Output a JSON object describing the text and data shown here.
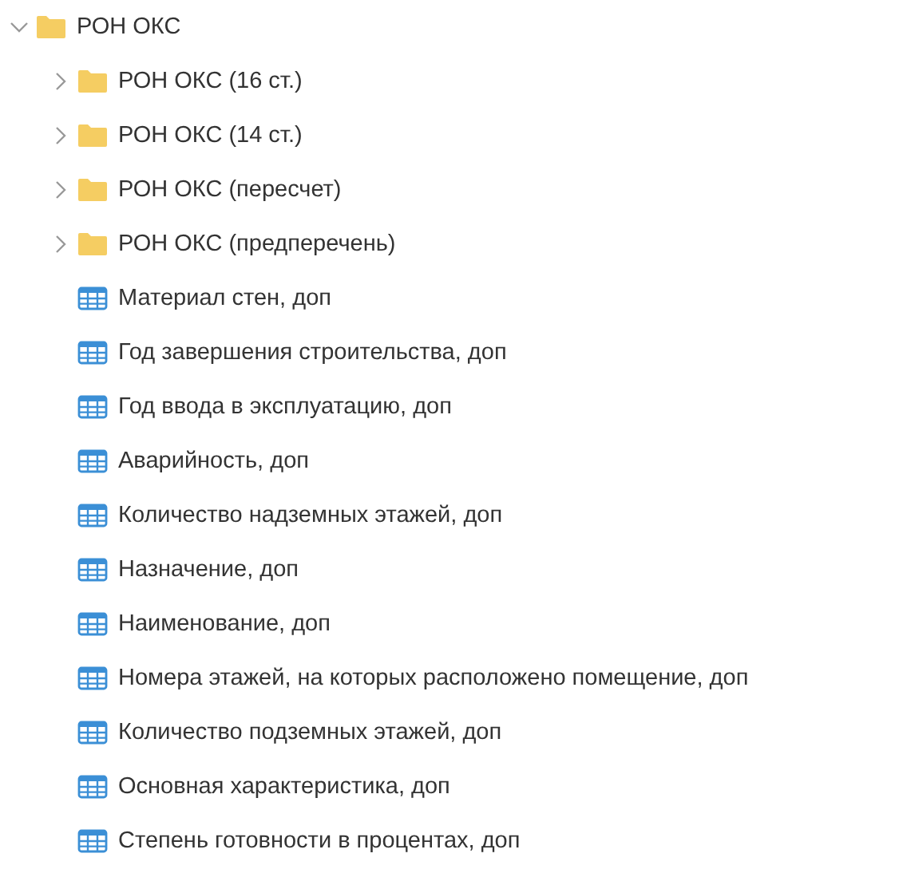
{
  "tree": [
    {
      "label": "РОН ОКС",
      "kind": "folder",
      "expanded": true,
      "children": [
        {
          "label": "РОН ОКС (16 ст.)",
          "kind": "folder",
          "expanded": false
        },
        {
          "label": "РОН ОКС (14 ст.)",
          "kind": "folder",
          "expanded": false
        },
        {
          "label": "РОН ОКС (пересчет)",
          "kind": "folder",
          "expanded": false
        },
        {
          "label": "РОН ОКС (предперечень)",
          "kind": "folder",
          "expanded": false
        },
        {
          "label": "Материал стен, доп",
          "kind": "table"
        },
        {
          "label": "Год завершения строительства, доп",
          "kind": "table"
        },
        {
          "label": "Год ввода в эксплуатацию, доп",
          "kind": "table"
        },
        {
          "label": "Аварийность, доп",
          "kind": "table"
        },
        {
          "label": "Количество надземных этажей, доп",
          "kind": "table"
        },
        {
          "label": "Назначение, доп",
          "kind": "table"
        },
        {
          "label": "Наименование, доп",
          "kind": "table"
        },
        {
          "label": "Номера этажей, на которых расположено помещение, доп",
          "kind": "table"
        },
        {
          "label": "Количество подземных этажей, доп",
          "kind": "table"
        },
        {
          "label": "Основная характеристика, доп",
          "kind": "table"
        },
        {
          "label": "Степень готовности в процентах, доп",
          "kind": "table"
        }
      ]
    }
  ]
}
